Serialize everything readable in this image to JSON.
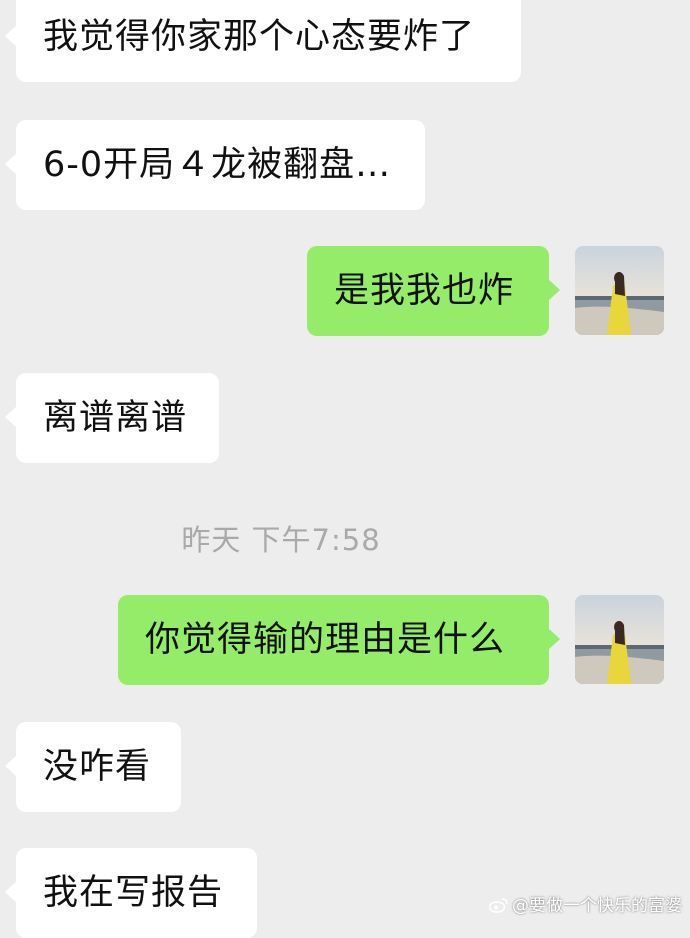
{
  "chat": {
    "messages": [
      {
        "side": "in",
        "text": "我觉得你家那个心态要炸了"
      },
      {
        "side": "in",
        "text": "6-0开局４龙被翻盘…"
      },
      {
        "side": "out",
        "text": "是我我也炸"
      },
      {
        "side": "in",
        "text": "离谱离谱"
      },
      {
        "side": "out",
        "text": "你觉得输的理由是什么"
      },
      {
        "side": "in",
        "text": "没咋看"
      },
      {
        "side": "in",
        "text": "我在写报告"
      }
    ],
    "timestamp": "昨天 下午7:58"
  },
  "watermark": {
    "text": "@要做一个快乐的富婆",
    "icon": "weibo-icon"
  },
  "colors": {
    "background": "#ededed",
    "incoming_bubble": "#ffffff",
    "outgoing_bubble": "#95ec69",
    "timestamp": "#a9a9a9"
  }
}
